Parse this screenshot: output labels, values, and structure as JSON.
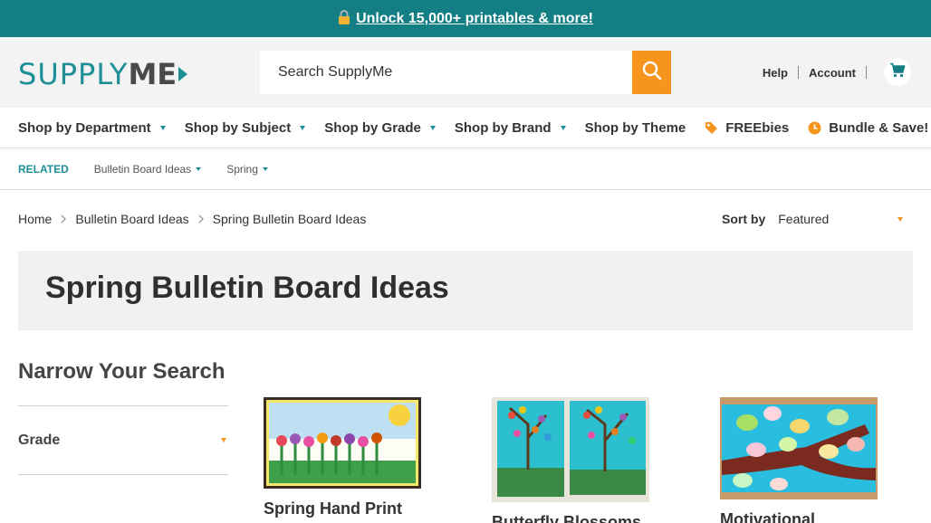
{
  "promo": {
    "icon": "lock-icon",
    "text": "Unlock 15,000+ printables & more!"
  },
  "header": {
    "logo": {
      "part1": "SUPPLY",
      "part2": "ME"
    },
    "search": {
      "placeholder": "Search SupplyMe"
    },
    "links": {
      "help": "Help",
      "account": "Account"
    }
  },
  "nav": {
    "items": [
      {
        "label": "Shop by Department"
      },
      {
        "label": "Shop by Subject"
      },
      {
        "label": "Shop by Grade"
      },
      {
        "label": "Shop by Brand"
      },
      {
        "label": "Shop by Theme"
      },
      {
        "label": "FREEbies",
        "icon": "tag-icon"
      },
      {
        "label": "Bundle & Save!",
        "icon": "clock-icon"
      }
    ]
  },
  "related": {
    "label": "RELATED",
    "items": [
      {
        "label": "Bulletin Board Ideas"
      },
      {
        "label": "Spring"
      }
    ]
  },
  "breadcrumb": [
    "Home",
    "Bulletin Board Ideas",
    "Spring Bulletin Board Ideas"
  ],
  "sort": {
    "label": "Sort by",
    "value": "Featured"
  },
  "page": {
    "title": "Spring Bulletin Board Ideas"
  },
  "sidebar": {
    "title": "Narrow Your Search",
    "facets": [
      {
        "label": "Grade"
      }
    ]
  },
  "products": [
    {
      "name": "Spring Hand Print"
    },
    {
      "name": "Butterfly Blossoms"
    },
    {
      "name": "Motivational"
    }
  ],
  "colors": {
    "teal": "#137f85",
    "orange": "#f7941d",
    "brand": "#1e8f97"
  }
}
